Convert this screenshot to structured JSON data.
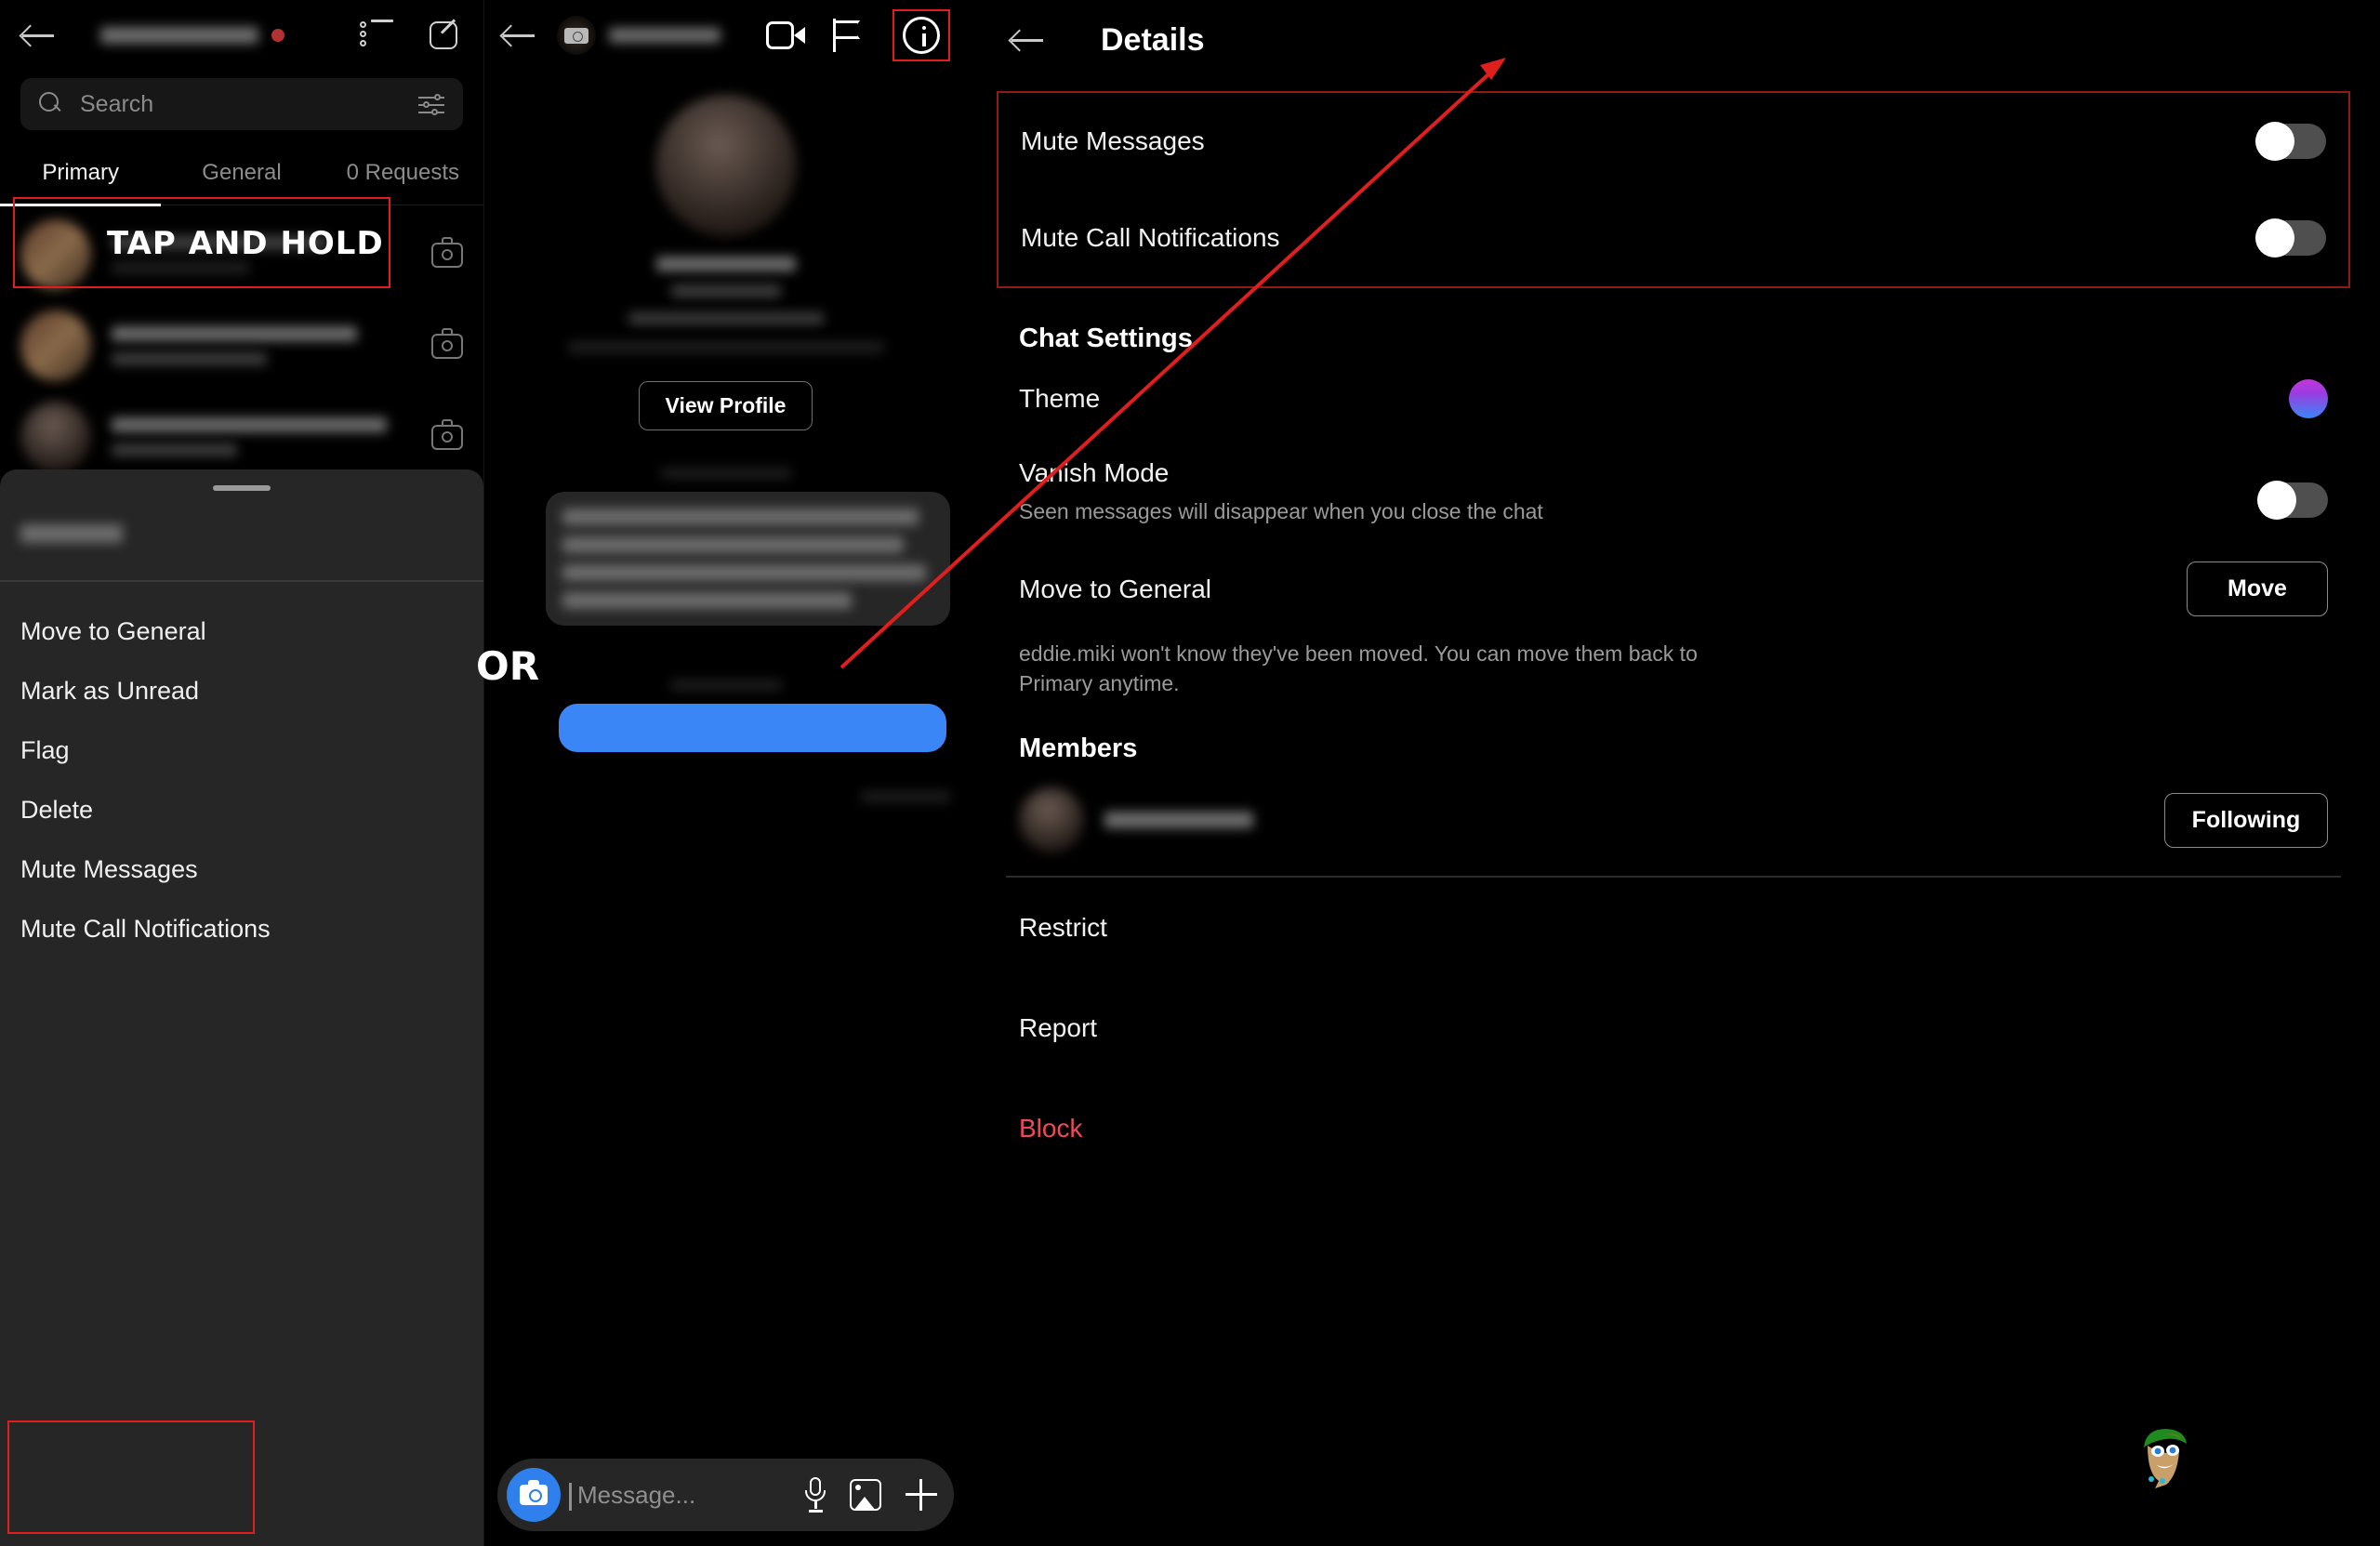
{
  "app": {
    "name": "Instagram Direct Messages",
    "accent": "#3a86f7",
    "danger": "#ed4956",
    "annotation_red": "#e01e1e"
  },
  "annotations": {
    "tap_and_hold": "TAP AND HOLD",
    "or": "OR"
  },
  "inbox_panel": {
    "back_icon": "back-arrow-icon",
    "list_icon": "list-icon",
    "compose_icon": "compose-icon",
    "search": {
      "placeholder": "Search",
      "icon": "search-icon",
      "filter_icon": "sliders-icon"
    },
    "tabs": [
      {
        "label": "Primary",
        "active": true
      },
      {
        "label": "General",
        "active": false
      },
      {
        "label": "0 Requests",
        "active": false
      }
    ],
    "conversations": [
      {
        "redacted": true,
        "camera_icon": "camera-icon",
        "highlighted": true
      },
      {
        "redacted": true,
        "camera_icon": "camera-icon",
        "highlighted": false
      },
      {
        "redacted": true,
        "camera_icon": "camera-icon",
        "highlighted": false
      }
    ],
    "action_sheet": {
      "grab_handle": true,
      "username_redacted": true,
      "items": [
        {
          "label": "Move to General",
          "highlighted": false
        },
        {
          "label": "Mark as Unread",
          "highlighted": false
        },
        {
          "label": "Flag",
          "highlighted": false
        },
        {
          "label": "Delete",
          "highlighted": false
        },
        {
          "label": "Mute Messages",
          "highlighted": true
        },
        {
          "label": "Mute Call Notifications",
          "highlighted": true
        }
      ]
    }
  },
  "chat_panel": {
    "back_icon": "back-arrow-icon",
    "avatar_icon": "avatar",
    "name_redacted": true,
    "video_icon": "video-call-icon",
    "flag_icon": "flag-icon",
    "info_icon": "info-icon",
    "info_highlighted": true,
    "view_profile_label": "View Profile",
    "composer": {
      "camera_icon": "camera-icon",
      "placeholder": "Message...",
      "mic_icon": "microphone-icon",
      "gallery_icon": "photo-icon",
      "plus_icon": "plus-icon"
    }
  },
  "details_panel": {
    "back_icon": "back-arrow-icon",
    "title": "Details",
    "mute_section": {
      "highlighted": true,
      "rows": [
        {
          "label": "Mute Messages",
          "toggle_on": false
        },
        {
          "label": "Mute Call Notifications",
          "toggle_on": false
        }
      ]
    },
    "chat_settings_title": "Chat Settings",
    "theme": {
      "label": "Theme",
      "swatch": "purple-blue-gradient"
    },
    "vanish_mode": {
      "label": "Vanish Mode",
      "description": "Seen messages will disappear when you close the chat",
      "toggle_on": false
    },
    "move_to_general": {
      "label": "Move to General",
      "button": "Move",
      "note": "eddie.miki won't know they've been moved. You can move them back to Primary anytime."
    },
    "members_title": "Members",
    "member": {
      "name_redacted": true,
      "button": "Following"
    },
    "actions": [
      {
        "label": "Restrict",
        "danger": false
      },
      {
        "label": "Report",
        "danger": false
      },
      {
        "label": "Block",
        "danger": true
      }
    ]
  }
}
